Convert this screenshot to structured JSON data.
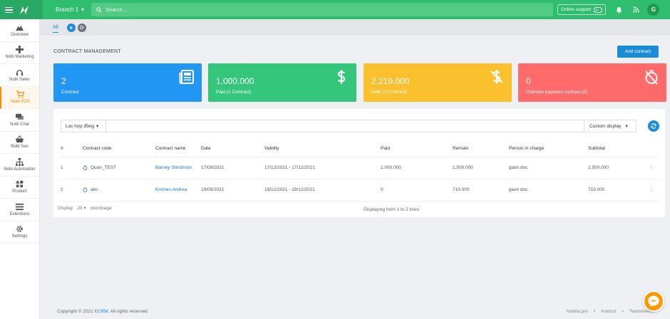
{
  "topbar": {
    "branch": "Branch 1",
    "search_placeholder": "Search...",
    "online_support": "Online support",
    "avatar_letter": "G"
  },
  "sidebar": {
    "items": [
      {
        "label": "Overview",
        "icon": "mountain-icon"
      },
      {
        "label": "Nobi Marketing",
        "icon": "gamepad-icon"
      },
      {
        "label": "Nobi Sales",
        "icon": "headset-icon"
      },
      {
        "label": "Nobi POS",
        "icon": "cart-icon",
        "active": true
      },
      {
        "label": "Nobi Chat",
        "icon": "chat-icon"
      },
      {
        "label": "Nobi San",
        "icon": "basket-icon"
      },
      {
        "label": "Nobi Automation",
        "icon": "sitemap-icon"
      },
      {
        "label": "Product",
        "icon": "shapes-icon"
      },
      {
        "label": "Extentions",
        "icon": "list-icon"
      },
      {
        "label": "Settings",
        "icon": "gear-icon"
      }
    ]
  },
  "tabs": {
    "all": "All"
  },
  "page": {
    "title": "CONTRACT MANAGEMENT",
    "add_button": "Add contract"
  },
  "cards": [
    {
      "value": "2",
      "label": "Contract",
      "color": "#2196f3",
      "icon": "newspaper-icon"
    },
    {
      "value": "1.000.000",
      "label": "Paid (1 Contract)",
      "color": "#34c77b",
      "icon": "dollar-icon"
    },
    {
      "value": "2.219.000",
      "label": "Debt (2 Contract)",
      "color": "#fbc02d",
      "icon": "dollar-slash-icon"
    },
    {
      "value": "0",
      "label": "Overdue payment contract (0)",
      "color": "#ff6b6b",
      "icon": "stopwatch-slash-icon"
    }
  ],
  "filter": {
    "select_label": "Lọc hợp đồng",
    "display_label": "Custom display"
  },
  "table": {
    "headers": [
      "#",
      "Contract code",
      "Contract name",
      "Date",
      "Validity",
      "Paid",
      "Remain",
      "Person in charge",
      "Subtotal"
    ],
    "rows": [
      {
        "no": "1",
        "code": "Quan_TEST",
        "name": "Barney Stinchson",
        "date": "17/09/2021",
        "validity": "17/12/2021 - 17/12/2021",
        "paid": "1.000.000",
        "remain": "1.500.000",
        "person": "giam doc",
        "subtotal": "2.500.000"
      },
      {
        "no": "2",
        "code": "abc",
        "name": "Krishen Andrea",
        "date": "19/09/2021",
        "validity": "19/12/2021 - 19/12/2021",
        "paid": "0",
        "remain": "719.000",
        "person": "giam doc",
        "subtotal": "719.000"
      }
    ]
  },
  "pager": {
    "display": "Display",
    "per_page": "20",
    "rows_page": "rows/page",
    "info": "Displaying from 1 to 2 lines"
  },
  "footer": {
    "copyright_pre": "Copyright © 2021",
    "brand": "ECRM.",
    "copyright_post": "All rights reserved.",
    "links": [
      "Nobita.pro",
      "Instruct",
      "Teamviewer"
    ]
  }
}
